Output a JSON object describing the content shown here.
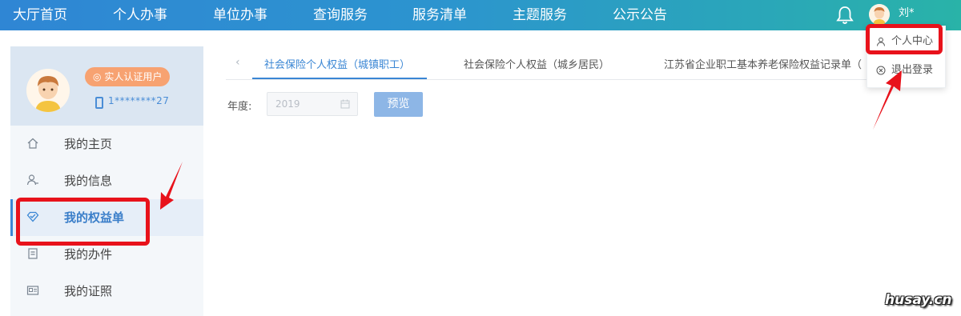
{
  "nav": {
    "items": [
      "大厅首页",
      "个人办事",
      "单位办事",
      "查询服务",
      "服务清单",
      "主题服务",
      "公示公告"
    ],
    "user_name": "刘*",
    "bell_icon": "bell-icon"
  },
  "user_dropdown": {
    "items": [
      {
        "label": "个人中心",
        "icon": "user-icon"
      },
      {
        "label": "退出登录",
        "icon": "logout-icon"
      }
    ]
  },
  "profile": {
    "badge": "实人认证用户",
    "phone": "1********27"
  },
  "sidebar": {
    "items": [
      {
        "label": "我的主页",
        "icon": "home-icon"
      },
      {
        "label": "我的信息",
        "icon": "user-info-icon"
      },
      {
        "label": "我的权益单",
        "icon": "shield-heart-icon",
        "active": true
      },
      {
        "label": "我的办件",
        "icon": "documents-icon"
      },
      {
        "label": "我的证照",
        "icon": "id-card-icon"
      }
    ]
  },
  "tabs": [
    {
      "label": "社会保险个人权益（城镇职工）",
      "active": true
    },
    {
      "label": "社会保险个人权益（城乡居民）"
    },
    {
      "label": "江苏省企业职工基本养老保险权益记录单（"
    }
  ],
  "filter": {
    "year_label": "年度:",
    "year_value": "2019",
    "preview_button": "预览"
  },
  "watermark": "husay.cn",
  "colors": {
    "accent": "#3a86d4",
    "annotation": "#e8121b",
    "badge": "#f7a271",
    "button": "#8db6e6"
  }
}
